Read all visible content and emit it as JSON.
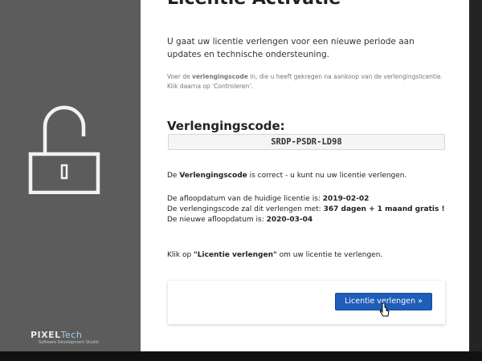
{
  "title": "Licentie Activatie",
  "intro": "U gaat uw licentie verlengen voor een nieuwe periode aan updates en technische ondersteuning.",
  "hint": {
    "pre": "Voer de ",
    "bold": "verlengingscode",
    "post": " in, die u heeft gekregen na aankoop van de verlengingslicentie. Klik daarna op 'Controleren'."
  },
  "code_label": "Verlengingscode:",
  "code_value": "SRDP-PSDR-LD98",
  "status": {
    "pre": "De ",
    "bold": "Verlengingscode",
    "post": " is correct - u kunt nu uw licentie verlengen."
  },
  "info": {
    "current_expiry_label": "De afloopdatum van de huidige licentie is: ",
    "current_expiry_value": "2019-02-02",
    "extend_label": "De verlengingscode zal dit verlengen met: ",
    "extend_value": "367 dagen + 1 maand gratis !",
    "new_expiry_label": "De nieuwe afloopdatum is: ",
    "new_expiry_value": "2020-03-04"
  },
  "cta": {
    "pre": "Klik op ",
    "bold": "\"Licentie verlengen\"",
    "post": " om uw licentie te verlengen."
  },
  "button_label": "Licentie verlengen »",
  "logo": {
    "main": "PIXEL",
    "accent": "Tech",
    "tagline": "Software Development Studio"
  },
  "icons": {
    "lock": "unlocked-padlock-icon",
    "cursor": "mouse-pointer-icon"
  },
  "colors": {
    "sidebar": "#5c5c5c",
    "button": "#1f5db8"
  }
}
